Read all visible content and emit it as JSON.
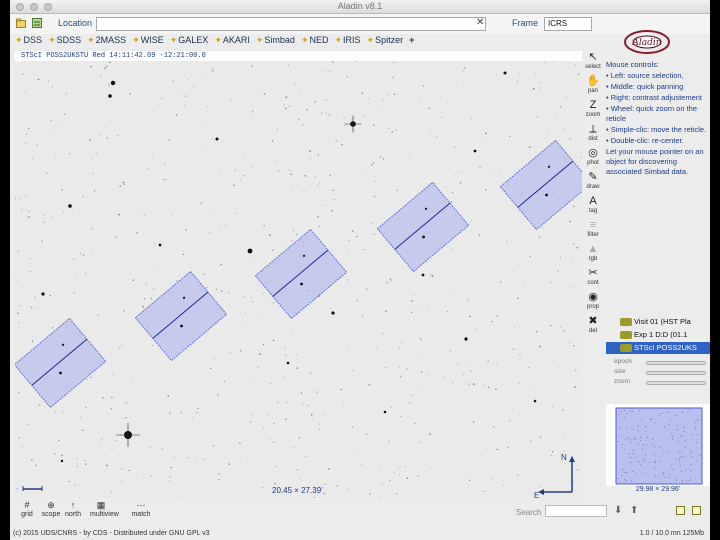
{
  "window": {
    "title": "Aladin v8.1"
  },
  "location": {
    "label": "Location",
    "value": ""
  },
  "frame": {
    "label": "Frame",
    "value": "ICRS"
  },
  "surveys": [
    "DSS",
    "SDSS",
    "2MASS",
    "WISE",
    "GALEX",
    "AKARI",
    "Simbad",
    "NED",
    "IRIS",
    "Spitzer"
  ],
  "survey_add": "+",
  "view": {
    "header": "STScI POSS2UKSTU Red 14:11:42.09 -12:21:00.0",
    "coord": "20.45 × 27.39'",
    "compass": {
      "north": "N",
      "east": "E"
    },
    "scale": "1'"
  },
  "tools": [
    {
      "label": "select",
      "icon": "cursor-icon"
    },
    {
      "label": "pan",
      "icon": "hand-icon"
    },
    {
      "label": "zoom",
      "icon": "zoom-icon"
    },
    {
      "label": "dist",
      "icon": "ruler-icon"
    },
    {
      "label": "phot",
      "icon": "phot-icon"
    },
    {
      "label": "draw",
      "icon": "pencil-icon"
    },
    {
      "label": "tag",
      "icon": "tag-icon"
    },
    {
      "label": "filter",
      "icon": "filter-icon"
    },
    {
      "label": "rgb",
      "icon": "rgb-icon"
    },
    {
      "label": "cont",
      "icon": "contour-icon"
    },
    {
      "label": "prop",
      "icon": "prop-icon"
    },
    {
      "label": "del",
      "icon": "delete-icon"
    }
  ],
  "help": {
    "title": "Mouse controls:",
    "lines": [
      "• Left: source selection,",
      "• Middle: quick panning",
      "• Right: contrast adjustement",
      "• Wheel: quick zoom on the reticle",
      "• Simple-clic: move the reticle.",
      "• Double-clic: re-center.",
      "Let your mouse pointer on an object for discovering associated Simbad data."
    ]
  },
  "stack": {
    "planes": [
      {
        "name": "Visit 01 (HST Pla",
        "selected": false
      },
      {
        "name": "Exp 1 D:D (01.1",
        "selected": false
      },
      {
        "name": "STScI POSS2UKS",
        "selected": true
      }
    ],
    "controls": [
      "epoch",
      "size",
      "zoom"
    ]
  },
  "preview": {
    "label": "29.98 × 29.96'"
  },
  "bottom": {
    "buttons": [
      "grid",
      "scope",
      "north",
      "multiview",
      "match"
    ],
    "search_label": "Search"
  },
  "status": {
    "left": "(c) 2015 UDS/CNRS - by CDS - Distributed under GNU GPL v3",
    "right": "1.0 / 10.0 mn   125Mb"
  },
  "colors": {
    "footprint": "#4a5cd6",
    "footprint_fill": "#b9c0ef",
    "panel_text": "#1a3c8e",
    "selection": "#2f63c3"
  }
}
